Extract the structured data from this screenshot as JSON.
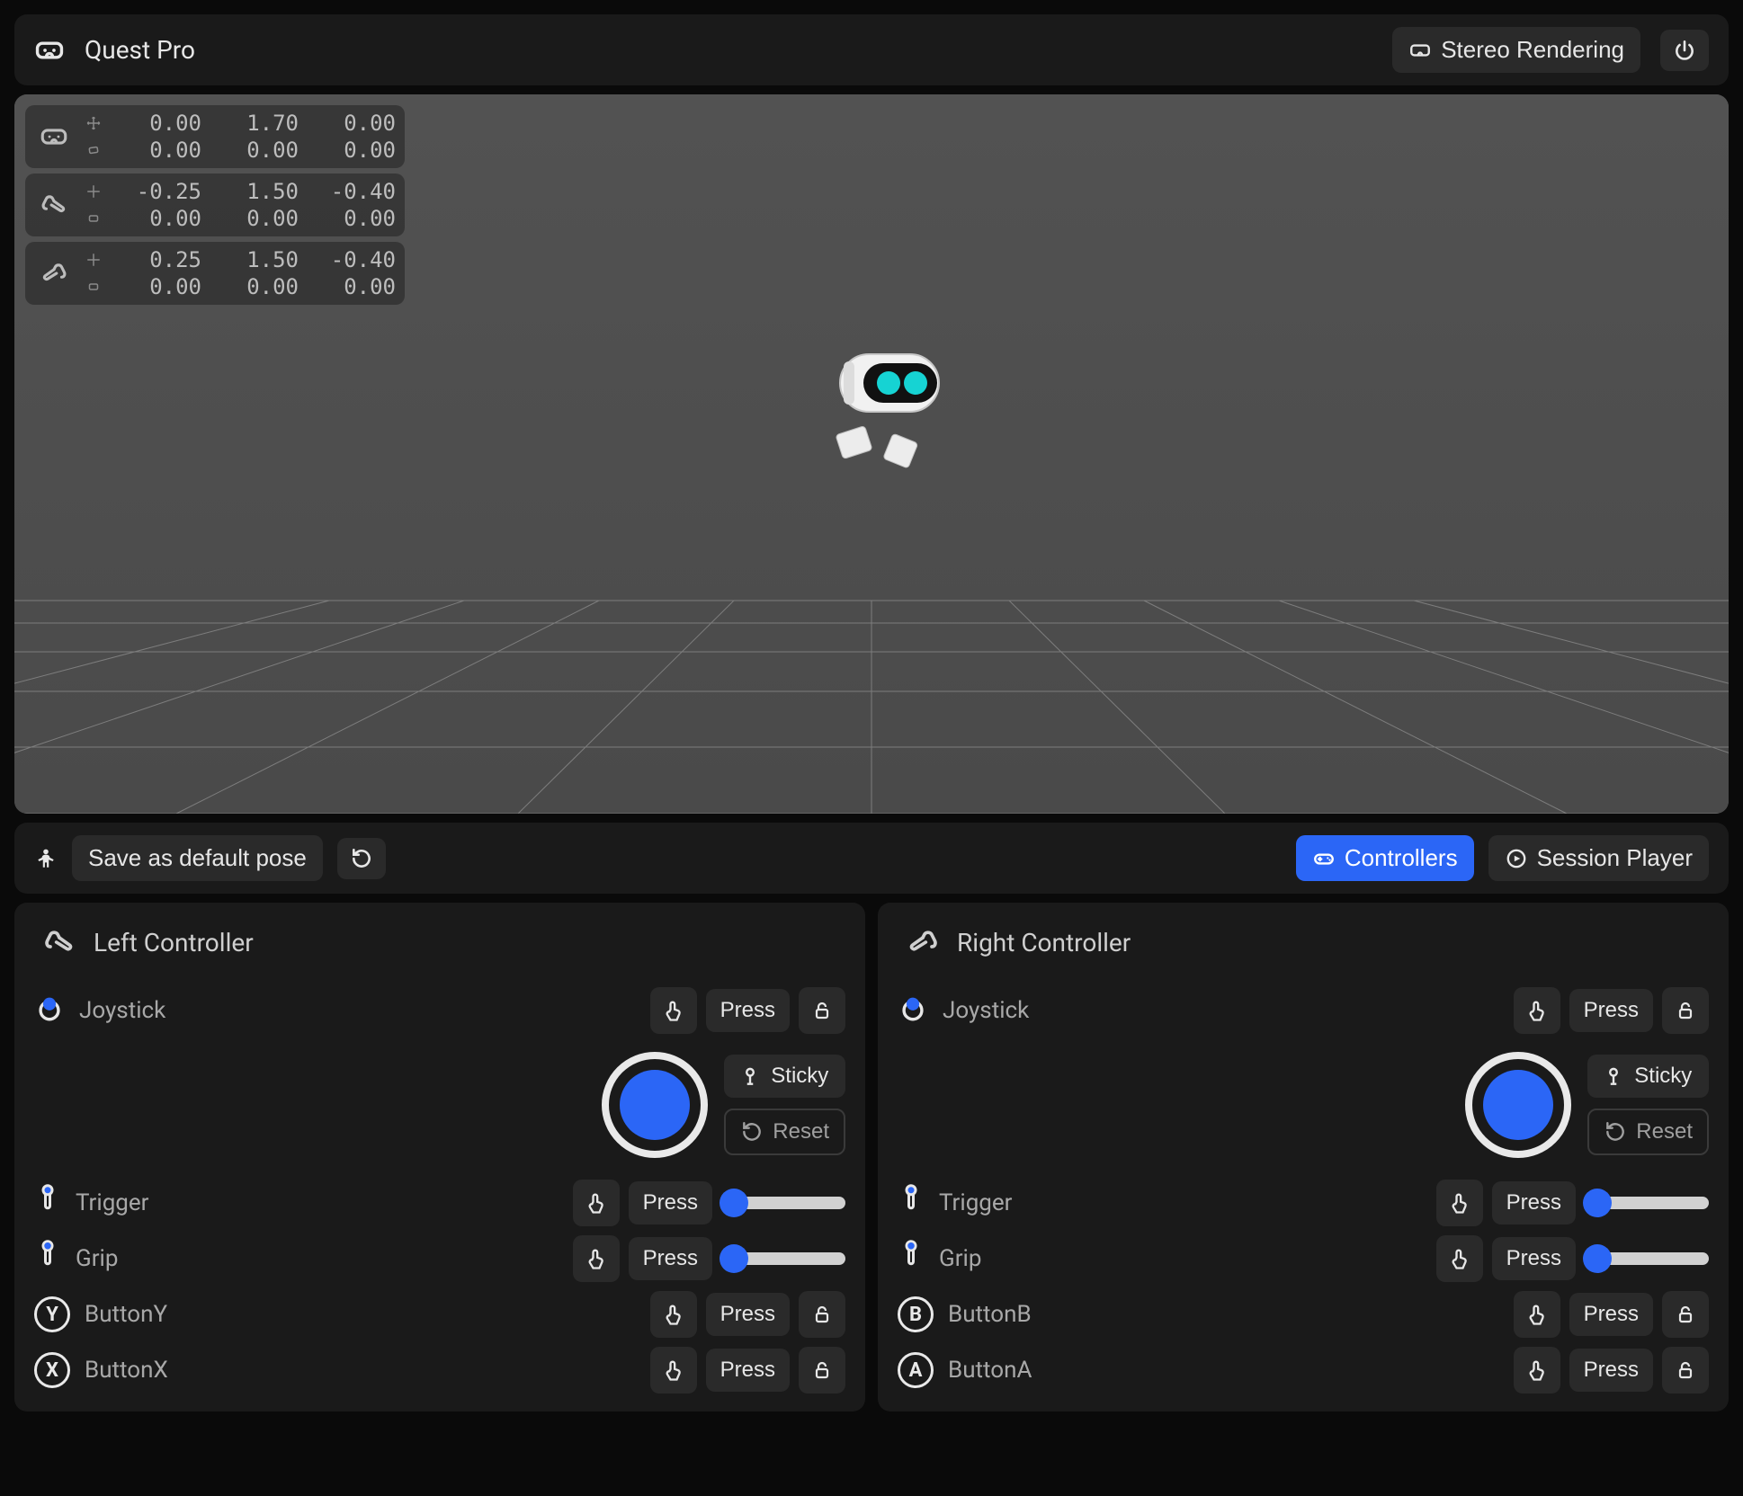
{
  "header": {
    "title": "Quest Pro",
    "stereo_button": "Stereo Rendering"
  },
  "overlay": {
    "headset": {
      "pos": [
        "0.00",
        "1.70",
        "0.00"
      ],
      "rot": [
        "0.00",
        "0.00",
        "0.00"
      ]
    },
    "left": {
      "pos": [
        "-0.25",
        "1.50",
        "-0.40"
      ],
      "rot": [
        "0.00",
        "0.00",
        "0.00"
      ]
    },
    "right": {
      "pos": [
        "0.25",
        "1.50",
        "-0.40"
      ],
      "rot": [
        "0.00",
        "0.00",
        "0.00"
      ]
    }
  },
  "posebar": {
    "save_button": "Save as default pose",
    "controllers_tab": "Controllers",
    "session_tab": "Session Player"
  },
  "strings": {
    "press": "Press",
    "sticky": "Sticky",
    "reset": "Reset"
  },
  "left_controller": {
    "title": "Left Controller",
    "joystick_label": "Joystick",
    "trigger_label": "Trigger",
    "grip_label": "Grip",
    "button_y_label": "ButtonY",
    "button_x_label": "ButtonX",
    "button_y_letter": "Y",
    "button_x_letter": "X"
  },
  "right_controller": {
    "title": "Right Controller",
    "joystick_label": "Joystick",
    "trigger_label": "Trigger",
    "grip_label": "Grip",
    "button_b_label": "ButtonB",
    "button_a_label": "ButtonA",
    "button_b_letter": "B",
    "button_a_letter": "A"
  }
}
